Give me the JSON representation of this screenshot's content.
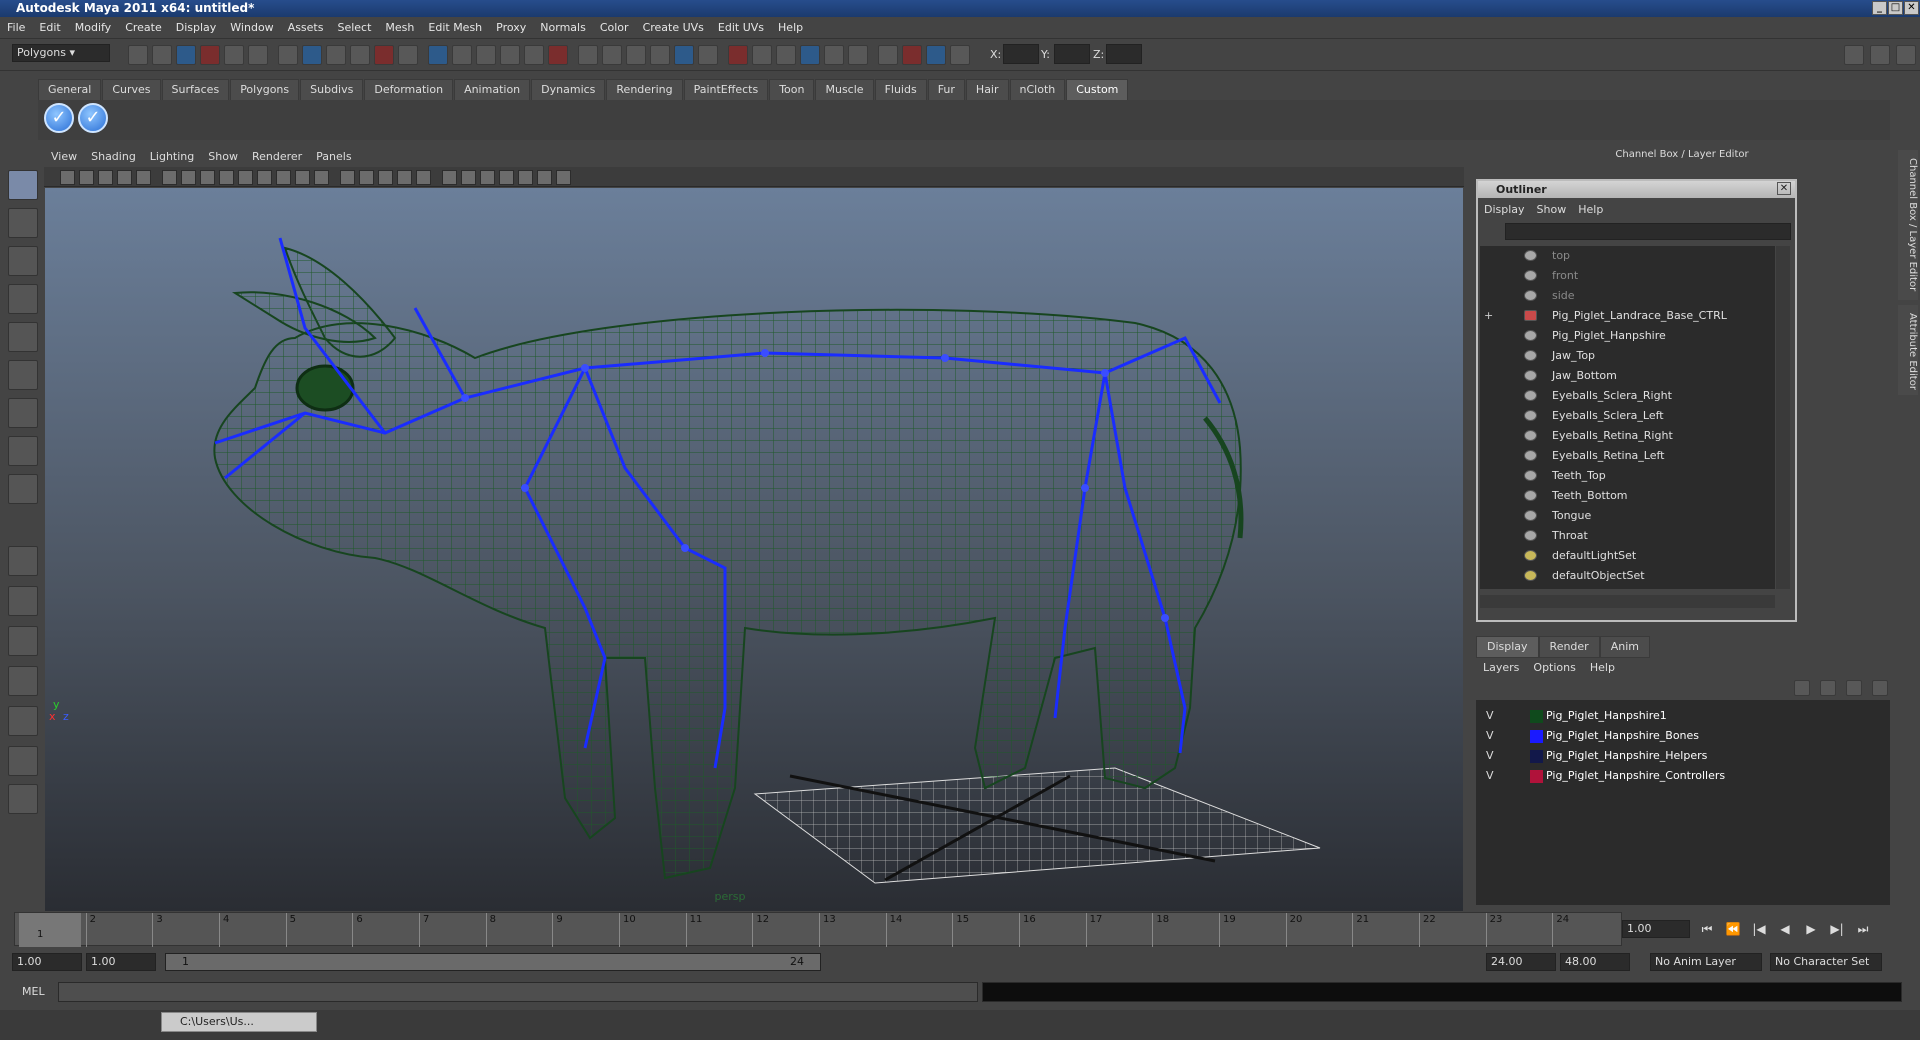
{
  "window": {
    "title": "Autodesk Maya 2011 x64: untitled*"
  },
  "menubar": [
    "File",
    "Edit",
    "Modify",
    "Create",
    "Display",
    "Window",
    "Assets",
    "Select",
    "Mesh",
    "Edit Mesh",
    "Proxy",
    "Normals",
    "Color",
    "Create UVs",
    "Edit UVs",
    "Help"
  ],
  "status": {
    "mode": "Polygons",
    "x_label": "X:",
    "y_label": "Y:",
    "z_label": "Z:"
  },
  "shelf": {
    "tabs": [
      "General",
      "Curves",
      "Surfaces",
      "Polygons",
      "Subdivs",
      "Deformation",
      "Animation",
      "Dynamics",
      "Rendering",
      "PaintEffects",
      "Toon",
      "Muscle",
      "Fluids",
      "Fur",
      "Hair",
      "nCloth",
      "Custom"
    ],
    "active": "Custom"
  },
  "viewport": {
    "menu": [
      "View",
      "Shading",
      "Lighting",
      "Show",
      "Renderer",
      "Panels"
    ],
    "camera": "persp",
    "axis_y": "y",
    "axis_x": "x",
    "axis_z": "z",
    "mesh_color": "#1f5a2a",
    "bone_color": "#1a2cff"
  },
  "channelbox": {
    "title": "Channel Box / Layer Editor",
    "side_tab_1": "Channel Box / Layer Editor",
    "side_tab_2": "Attribute Editor"
  },
  "outliner": {
    "title": "Outliner",
    "menu": [
      "Display",
      "Show",
      "Help"
    ],
    "items": [
      {
        "label": "top",
        "dim": true,
        "icon": "camera-icon"
      },
      {
        "label": "front",
        "dim": true,
        "icon": "camera-icon"
      },
      {
        "label": "side",
        "dim": true,
        "icon": "camera-icon"
      },
      {
        "label": "Pig_Piglet_Landrace_Base_CTRL",
        "dim": false,
        "icon": "curve-icon",
        "expand": "+"
      },
      {
        "label": "Pig_Piglet_Hanpshire",
        "dim": false,
        "icon": "mesh-icon"
      },
      {
        "label": "Jaw_Top",
        "dim": false,
        "icon": "mesh-icon"
      },
      {
        "label": "Jaw_Bottom",
        "dim": false,
        "icon": "mesh-icon"
      },
      {
        "label": "Eyeballs_Sclera_Right",
        "dim": false,
        "icon": "mesh-icon"
      },
      {
        "label": "Eyeballs_Sclera_Left",
        "dim": false,
        "icon": "mesh-icon"
      },
      {
        "label": "Eyeballs_Retina_Right",
        "dim": false,
        "icon": "mesh-icon"
      },
      {
        "label": "Eyeballs_Retina_Left",
        "dim": false,
        "icon": "mesh-icon"
      },
      {
        "label": "Teeth_Top",
        "dim": false,
        "icon": "mesh-icon"
      },
      {
        "label": "Teeth_Bottom",
        "dim": false,
        "icon": "mesh-icon"
      },
      {
        "label": "Tongue",
        "dim": false,
        "icon": "mesh-icon"
      },
      {
        "label": "Throat",
        "dim": false,
        "icon": "mesh-icon"
      },
      {
        "label": "defaultLightSet",
        "dim": false,
        "icon": "set-icon"
      },
      {
        "label": "defaultObjectSet",
        "dim": false,
        "icon": "set-icon"
      }
    ]
  },
  "layers": {
    "tabs": [
      "Display",
      "Render",
      "Anim"
    ],
    "active": "Display",
    "menu": [
      "Layers",
      "Options",
      "Help"
    ],
    "items": [
      {
        "v": "V",
        "name": "Pig_Piglet_Hanpshire1",
        "color": "#0f4a1c"
      },
      {
        "v": "V",
        "name": "Pig_Piglet_Hanpshire_Bones",
        "color": "#1a1aff"
      },
      {
        "v": "V",
        "name": "Pig_Piglet_Hanpshire_Helpers",
        "color": "#12184a"
      },
      {
        "v": "V",
        "name": "Pig_Piglet_Hanpshire_Controllers",
        "color": "#b0123a"
      }
    ]
  },
  "timeline": {
    "ticks": [
      "1",
      "2",
      "3",
      "4",
      "5",
      "6",
      "7",
      "8",
      "9",
      "10",
      "11",
      "12",
      "13",
      "14",
      "15",
      "16",
      "17",
      "18",
      "19",
      "20",
      "21",
      "22",
      "23",
      "24"
    ],
    "current_frame_label": "1",
    "current": "1.00"
  },
  "range": {
    "start": "1.00",
    "inner_start": "1.00",
    "slider_start": "1",
    "slider_end": "24",
    "inner_end": "24.00",
    "end": "48.00",
    "anim_layer": "No Anim Layer",
    "char_set": "No Character Set"
  },
  "cmdline": {
    "label": "MEL"
  },
  "taskbar": {
    "window_label": "C:\\Users\\Us..."
  }
}
